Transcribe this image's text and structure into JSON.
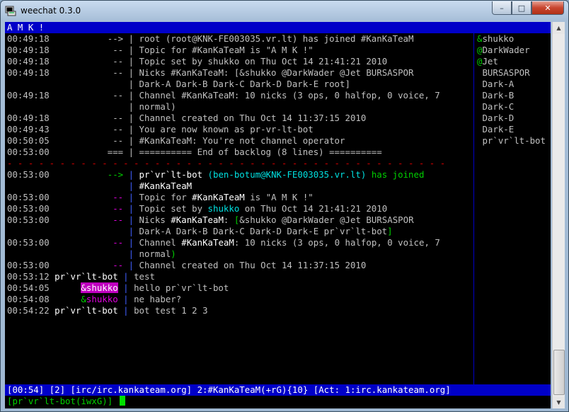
{
  "window": {
    "title": "weechat 0.3.0",
    "controls": {
      "minimize": "–",
      "maximize": "□",
      "close": "✕"
    }
  },
  "topic": "A M K !",
  "backlog": [
    {
      "time": "00:49:18",
      "prefix": "-->",
      "text": "root (root@KNK-FE003035.vr.lt) has joined #KanKaTeaM"
    },
    {
      "time": "00:49:18",
      "prefix": "--",
      "text": "Topic for #KanKaTeaM is \"A M K !\""
    },
    {
      "time": "00:49:18",
      "prefix": "--",
      "text": "Topic set by shukko on Thu Oct 14 21:41:21 2010"
    },
    {
      "time": "00:49:18",
      "prefix": "--",
      "text": "Nicks #KanKaTeaM: [&shukko @DarkWader @Jet BURSASPOR"
    },
    {
      "time": "",
      "prefix": "",
      "text": "Dark-A Dark-B Dark-C Dark-D Dark-E root]"
    },
    {
      "time": "00:49:18",
      "prefix": "--",
      "text": "Channel #KanKaTeaM: 10 nicks (3 ops, 0 halfop, 0 voice, 7"
    },
    {
      "time": "",
      "prefix": "",
      "text": "normal)"
    },
    {
      "time": "00:49:18",
      "prefix": "--",
      "text": "Channel created on Thu Oct 14 11:37:15 2010"
    },
    {
      "time": "00:49:43",
      "prefix": "--",
      "text": "You are now known as pr-vr-lt-bot"
    },
    {
      "time": "00:50:05",
      "prefix": "--",
      "text": "#KanKaTeaM: You're not channel operator"
    },
    {
      "time": "00:53:00",
      "prefix": "===",
      "text": "========== End of backlog (8 lines) =========="
    }
  ],
  "live": {
    "join": {
      "time": "00:53:00",
      "prefix": "-->",
      "nick": "pr`vr`lt-bot",
      "host": "(ben-botum@KNK-FE003035.vr.lt)",
      "action": "has joined",
      "channel": "#KanKaTeaM"
    },
    "topic_is": {
      "time": "00:53:00",
      "prefix": "--",
      "pre": "Topic for ",
      "channel": "#KanKaTeaM",
      "post": " is \"A M K !\""
    },
    "topic_set": {
      "time": "00:53:00",
      "prefix": "--",
      "pre": "Topic set by ",
      "nick": "shukko",
      "post": " on Thu Oct 14 21:41:21 2010"
    },
    "nicks": {
      "time": "00:53:00",
      "prefix": "--",
      "pre": "Nicks ",
      "channel": "#KanKaTeaM",
      "colon": ": ",
      "open": "[",
      "n1": "&shukko",
      "n2": "@DarkWader",
      "n3": "@Jet",
      "n4": "BURSASPOR",
      "line2": "Dark-A Dark-B Dark-C Dark-D Dark-E pr`vr`lt-bot",
      "close": "]"
    },
    "channel": {
      "time": "00:53:00",
      "prefix": "--",
      "pre": "Channel ",
      "channel": "#KanKaTeaM",
      "mid": ": 10 nicks (",
      "ops": "3",
      "ops_t": " ops, ",
      "halfop": "0",
      "halfop_t": " halfop, ",
      "voice": "0",
      "voice_t": " voice, ",
      "normal": "7",
      "line2": "normal",
      "end": ")"
    },
    "created": {
      "time": "00:53:00",
      "prefix": "--",
      "pre": "Channel created on ",
      "date": "Thu Oct 14 11:37:15 2010"
    }
  },
  "messages": [
    {
      "time": "00:53:12",
      "nick": "pr`vr`lt-bot",
      "text": "test"
    },
    {
      "time": "00:54:05",
      "nick": "&shukko",
      "text": "hello pr`vr`lt-bot"
    },
    {
      "time": "00:54:08",
      "nick": "&shukko",
      "text": "ne haber?"
    },
    {
      "time": "00:54:22",
      "nick": "pr`vr`lt-bot",
      "text": "bot test 1 2 3"
    }
  ],
  "separator": "- - - - - - - - - - - - - - - - - - - - - - - - - - - - - - - - - - - - - - - - - -",
  "pipe": "|",
  "nicklist": [
    "&shukko",
    "@DarkWader",
    "@Jet",
    " BURSASPOR",
    " Dark-A",
    " Dark-B",
    " Dark-C",
    " Dark-D",
    " Dark-E",
    " pr`vr`lt-bot"
  ],
  "status": {
    "time": "[00:54]",
    "window_no": "[2]",
    "server": "[irc/irc.kankateam.org]",
    "buffer_no": "2:",
    "channel": "#KanKaTeaM",
    "modes": "(+rG)",
    "nick_count": "{10}",
    "act": "[Act: 1:irc.kankateam.org]"
  },
  "input": {
    "prompt": "[pr`vr`lt-bot(iwxG)]"
  },
  "colors": {
    "blue_bar": "#0000c8",
    "terminal_bg": "#000000",
    "green": "#00d000",
    "cyan": "#00e0e0",
    "magenta": "#e000e0",
    "cursor": "#00e000"
  }
}
